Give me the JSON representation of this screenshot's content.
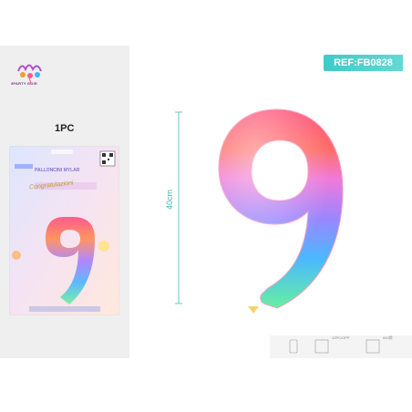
{
  "brand": {
    "name": "3PARTY GO!E"
  },
  "product": {
    "quantity_label": "1PC",
    "ref": "REF:FB0828",
    "size_label": "40cm",
    "digit": "9"
  },
  "package": {
    "title": "PALLONCINI MYLAR",
    "ribbon": "Congratulazioni"
  },
  "info_strip": {
    "items": [
      "12PC/OPP",
      "600袋"
    ]
  }
}
